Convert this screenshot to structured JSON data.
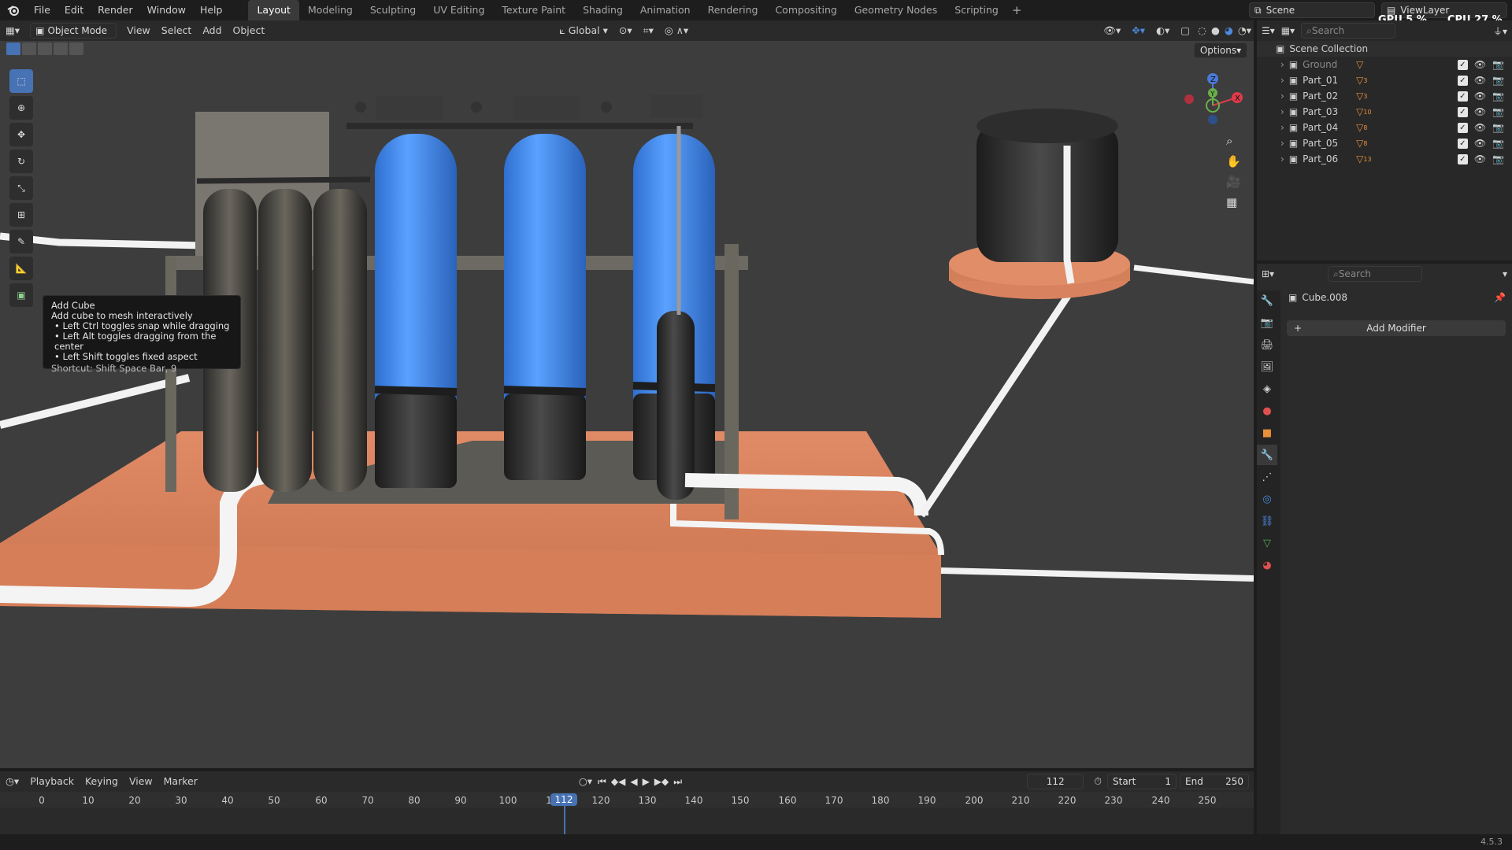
{
  "menu": [
    "File",
    "Edit",
    "Render",
    "Window",
    "Help"
  ],
  "workspaces": [
    "Layout",
    "Modeling",
    "Sculpting",
    "UV Editing",
    "Texture Paint",
    "Shading",
    "Animation",
    "Rendering",
    "Compositing",
    "Geometry Nodes",
    "Scripting"
  ],
  "scene_field": "Scene",
  "view_layer_field": "ViewLayer",
  "gpu_label": "GPU",
  "gpu_value": "5 %",
  "cpu_label": "CPU",
  "cpu_value": "27 %",
  "viewport_header": {
    "mode": "Object Mode",
    "items": [
      "View",
      "Select",
      "Add",
      "Object"
    ],
    "orientation": "Global",
    "options": "Options"
  },
  "tooltip": {
    "title": "Add Cube",
    "desc": "Add cube to mesh interactively",
    "lines": [
      "Left Ctrl toggles snap while dragging",
      "Left Alt toggles dragging from the center",
      "Left Shift toggles fixed aspect"
    ],
    "shortcut": "Shortcut: Shift Space Bar, 9"
  },
  "outliner": {
    "search_placeholder": "Search",
    "collection": "Scene Collection",
    "items": [
      {
        "name": "Ground",
        "badge": ""
      },
      {
        "name": "Part_01",
        "badge": "3"
      },
      {
        "name": "Part_02",
        "badge": "3"
      },
      {
        "name": "Part_03",
        "badge": "10"
      },
      {
        "name": "Part_04",
        "badge": "8"
      },
      {
        "name": "Part_05",
        "badge": "8"
      },
      {
        "name": "Part_06",
        "badge": "13"
      }
    ]
  },
  "properties": {
    "search_placeholder": "Search",
    "object_name": "Cube.008",
    "add_modifier": "Add Modifier"
  },
  "timeline": {
    "menus": [
      "Playback",
      "Keying",
      "View",
      "Marker"
    ],
    "current_frame": "112",
    "start_label": "Start",
    "start_value": "1",
    "end_label": "End",
    "end_value": "250",
    "ticks": [
      "0",
      "10",
      "20",
      "30",
      "40",
      "50",
      "60",
      "70",
      "80",
      "90",
      "100",
      "1",
      "120",
      "130",
      "140",
      "150",
      "160",
      "170",
      "180",
      "190",
      "200",
      "210",
      "220",
      "230",
      "240",
      "250"
    ],
    "playhead": "112"
  },
  "version": "4.5.3",
  "colors": {
    "accent": "#4772b3",
    "platform": "#d9825f",
    "tank_blue": "#3d8ae8",
    "ground": "#3d3d3d"
  }
}
